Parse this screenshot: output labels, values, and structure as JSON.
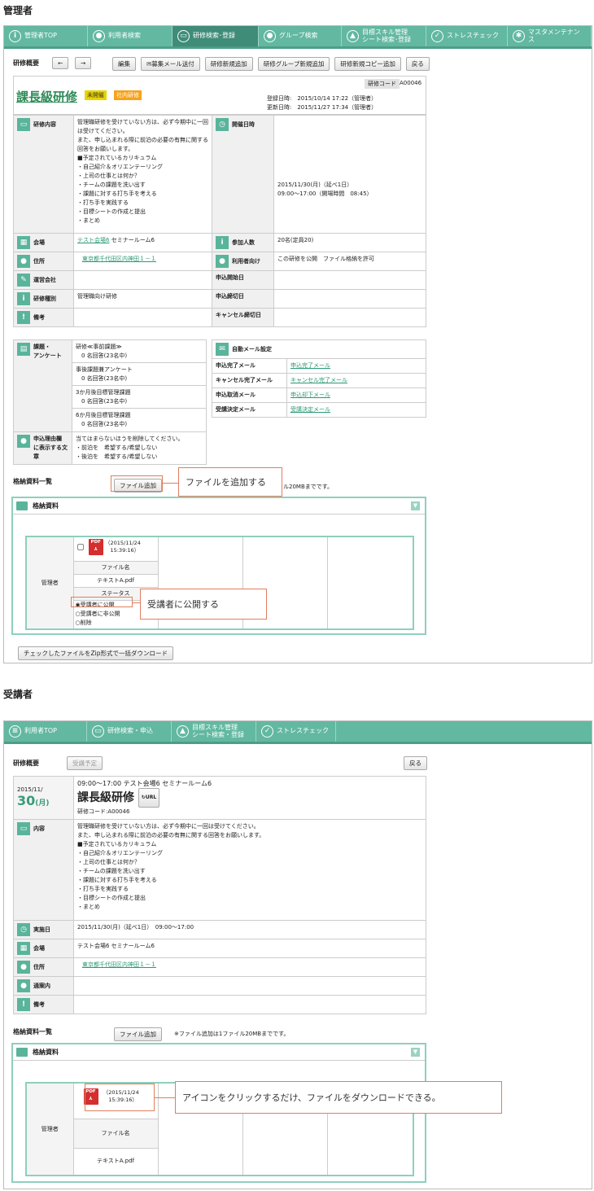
{
  "admin": {
    "section_title": "管理者",
    "nav": [
      {
        "label": "管理者TOP",
        "icon": "info-icon",
        "glyph": "i"
      },
      {
        "label": "利用者検索",
        "icon": "user-icon",
        "glyph": "●"
      },
      {
        "label": "研修検索･登録",
        "icon": "training-icon",
        "glyph": "▭"
      },
      {
        "label": "グループ検索",
        "icon": "group-icon",
        "glyph": "●"
      },
      {
        "label": "目標スキル管理\nシート検索･登録",
        "icon": "chart-icon",
        "glyph": "▲"
      },
      {
        "label": "ストレスチェック",
        "icon": "check-icon",
        "glyph": "✓"
      },
      {
        "label": "マスタメンテナンス",
        "icon": "gear-icon",
        "glyph": "✱"
      }
    ],
    "toolbar": {
      "label": "研修概要",
      "prev": "←",
      "next": "→",
      "buttons": [
        "編集",
        "募集メール送付",
        "研修新規追加",
        "研修グループ新規追加",
        "研修新規コピー追加",
        "戻る"
      ]
    },
    "training": {
      "title": "課長級研修",
      "badge_status": "未開催",
      "badge_type": "社内研修",
      "code_label": "研修コード",
      "code": "A00046",
      "registered": "登録日時:　2015/10/14 17:22（管理者）",
      "updated": "更新日時:　2015/11/27 17:34（管理者）"
    },
    "details": {
      "content_label": "研修内容",
      "content_text": "管理職研修を受けていない方は、必ず今期中に一回は受けてください。\nまた、申し込まれる際に前泊の必要の有無に関する回答をお願いします。\n■予定されているカリキュラム\n・自己紹介＆オリエンテーリング\n・上司の仕事とは何か？\n・チームの課題を洗い出す\n・課題に対する打ち手を考える\n・打ち手を実践する\n・目標シートの作成と提出\n・まとめ",
      "date_label": "開催日時",
      "date_text": "2015/11/30(月)（延べ1日）\n09:00〜17:00（開場時間　08:45）",
      "venue_label": "会場",
      "venue_link": "テスト会場6",
      "venue_room": " セミナールーム6",
      "participants_label": "参加人数",
      "participants_value": "20名(定員20)",
      "address_label": "住所",
      "address_value": "東京都千代田区内神田１－１",
      "target_label": "利用者向け",
      "target_value": "この研修を公開　ファイル格納を許可",
      "org_label": "運営会社",
      "apply_start_label": "申込開始日",
      "kind_label": "研修種別",
      "kind_value": "管理職向け研修",
      "apply_end_label": "申込締切日",
      "note_label": "備考",
      "cancel_end_label": "キャンセル締切日"
    },
    "survey": {
      "label": "課題・\nアンケート",
      "items": [
        "研修≪事前課題≫\n　0 名回答(23名中)",
        "事後課題兼アンケート\n　0 名回答(23名中)",
        "3か月後目標管理課題\n　0 名回答(23名中)",
        "6か月後目標管理課題\n　0 名回答(23名中)"
      ],
      "reason_label": "申込理由欄\nに表示する文\n章",
      "reason_text": "当てはまらないほうを削除してください。\n・前泊を　希望する/希望しない\n・後泊を　希望する/希望しない"
    },
    "mail": {
      "header": "自動メール設定",
      "rows": [
        {
          "label": "申込完了メール",
          "link": "申込完了メール"
        },
        {
          "label": "キャンセル完了メール",
          "link": "キャンセル完了メール"
        },
        {
          "label": "申込取消メール",
          "link": "申込却下メール"
        },
        {
          "label": "受講決定メール",
          "link": "受講決定メール"
        }
      ]
    },
    "files": {
      "label": "格納資料一覧",
      "add_button": "ファイル追加",
      "note_suffix": "ル20MBまでです。",
      "panel_title": "格納資料",
      "row_label": "管理者",
      "file_date": "（2015/11/24\n　15:39:16）",
      "file_name_header": "ファイル名",
      "file_name": "テキストA.pdf",
      "status_header": "ステータス",
      "options": [
        "受講者に公開",
        "受講者に非公開",
        "削除"
      ],
      "zip_button": "チェックしたファイルをZip形式で一括ダウンロード"
    },
    "callouts": {
      "add_file": "ファイルを追加する",
      "publish": "受講者に公開する"
    }
  },
  "trainee": {
    "section_title": "受講者",
    "nav": [
      {
        "label": "利用者TOP",
        "icon": "list-icon",
        "glyph": "≡"
      },
      {
        "label": "研修検索・申込",
        "icon": "training-icon",
        "glyph": "▭"
      },
      {
        "label": "目標スキル管理\nシート検索・登録",
        "icon": "chart-icon",
        "glyph": "▲"
      },
      {
        "label": "ストレスチェック",
        "icon": "check-icon",
        "glyph": "✓"
      }
    ],
    "toolbar": {
      "label": "研修概要",
      "status_button": "受講予定",
      "back_button": "戻る"
    },
    "training": {
      "year_month": "2015/11/",
      "day": "30",
      "weekday": "(月)",
      "time_place": "09:00〜17:00 テスト会場6 セミナールーム6",
      "title": "課長級研修",
      "url_button": "URL",
      "code": "研修コード:A00046"
    },
    "details": {
      "content_label": "内容",
      "content_text": "管理職研修を受けていない方は、必ず今期中に一回は受けてください。\nまた、申し込まれる際に前泊の必要の有無に関する回答をお願いします。\n■予定されているカリキュラム\n・自己紹介＆オリエンテーリング\n・上司の仕事とは何か？\n・チームの課題を洗い出す\n・課題に対する打ち手を考える\n・打ち手を実践する\n・目標シートの作成と提出\n・まとめ",
      "date_label": "実施日",
      "date_value": "2015/11/30(月)（延べ1日）　09:00〜17:00",
      "venue_label": "会場",
      "venue_value": "テスト会場6 セミナールーム6",
      "address_label": "住所",
      "address_value": "東京都千代田区内神田１－１",
      "guide_label": "通案内",
      "note_label": "備考"
    },
    "files": {
      "label": "格納資料一覧",
      "add_button": "ファイル追加",
      "note": "※ファイル追加は1ファイル20MBまでです。",
      "panel_title": "格納資料",
      "row_label": "管理者",
      "file_date": "（2015/11/24\n　15:39:16）",
      "file_name_header": "ファイル名",
      "file_name": "テキストA.pdf"
    },
    "callout": "アイコンをクリックするだけ、ファイルをダウンロードできる。"
  }
}
